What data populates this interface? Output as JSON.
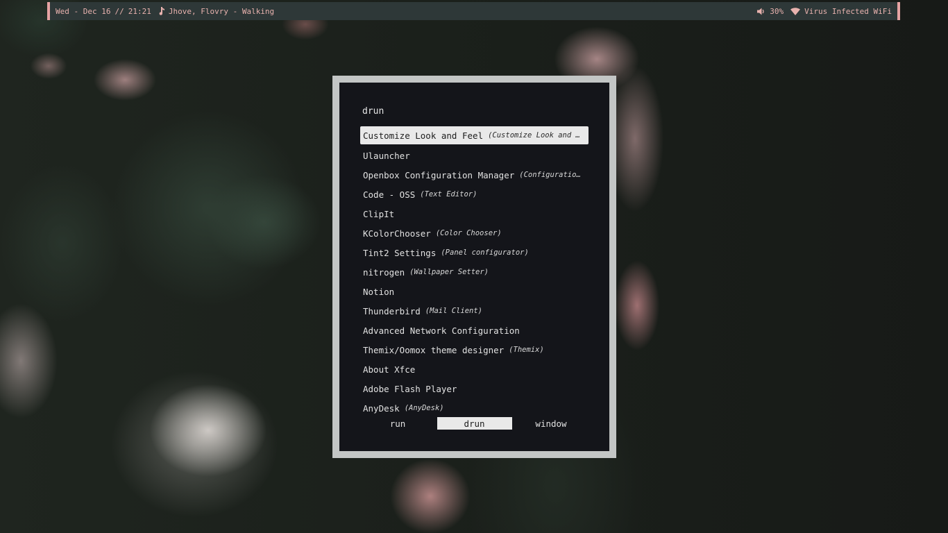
{
  "topbar": {
    "date": "Wed - Dec 16",
    "separator": "//",
    "time": "21:21",
    "now_playing": "Jhove, Flovry - Walking",
    "volume": "30%",
    "network": "Virus Infected WiFi",
    "icons": [
      "music-note-icon",
      "speaker-icon",
      "wifi-icon"
    ],
    "colors": {
      "text": "#e8b2ae",
      "background": "#2e3838",
      "accent": "#e6a3a3"
    }
  },
  "launcher": {
    "prompt": "drun",
    "entries": [
      {
        "name": "Customize Look and Feel",
        "desc": "(Customize Look and Feel)",
        "selected": true
      },
      {
        "name": "Ulauncher",
        "desc": ""
      },
      {
        "name": "Openbox Configuration Manager",
        "desc": "(Configuration Ma…"
      },
      {
        "name": "Code - OSS",
        "desc": "(Text Editor)"
      },
      {
        "name": "ClipIt",
        "desc": ""
      },
      {
        "name": "KColorChooser",
        "desc": "(Color Chooser)"
      },
      {
        "name": "Tint2 Settings",
        "desc": "(Panel configurator)"
      },
      {
        "name": "nitrogen",
        "desc": "(Wallpaper Setter)"
      },
      {
        "name": "Notion",
        "desc": ""
      },
      {
        "name": "Thunderbird",
        "desc": "(Mail Client)"
      },
      {
        "name": "Advanced Network Configuration",
        "desc": ""
      },
      {
        "name": "Themix/Oomox theme designer",
        "desc": "(Themix)"
      },
      {
        "name": "About Xfce",
        "desc": ""
      },
      {
        "name": "Adobe Flash Player",
        "desc": ""
      },
      {
        "name": "AnyDesk",
        "desc": "(AnyDesk)"
      }
    ],
    "modes": [
      "run",
      "drun",
      "window"
    ],
    "active_mode": "drun",
    "colors": {
      "border": "#c3c6c5",
      "background": "#14151a",
      "selection": "#e9e9e9"
    }
  }
}
